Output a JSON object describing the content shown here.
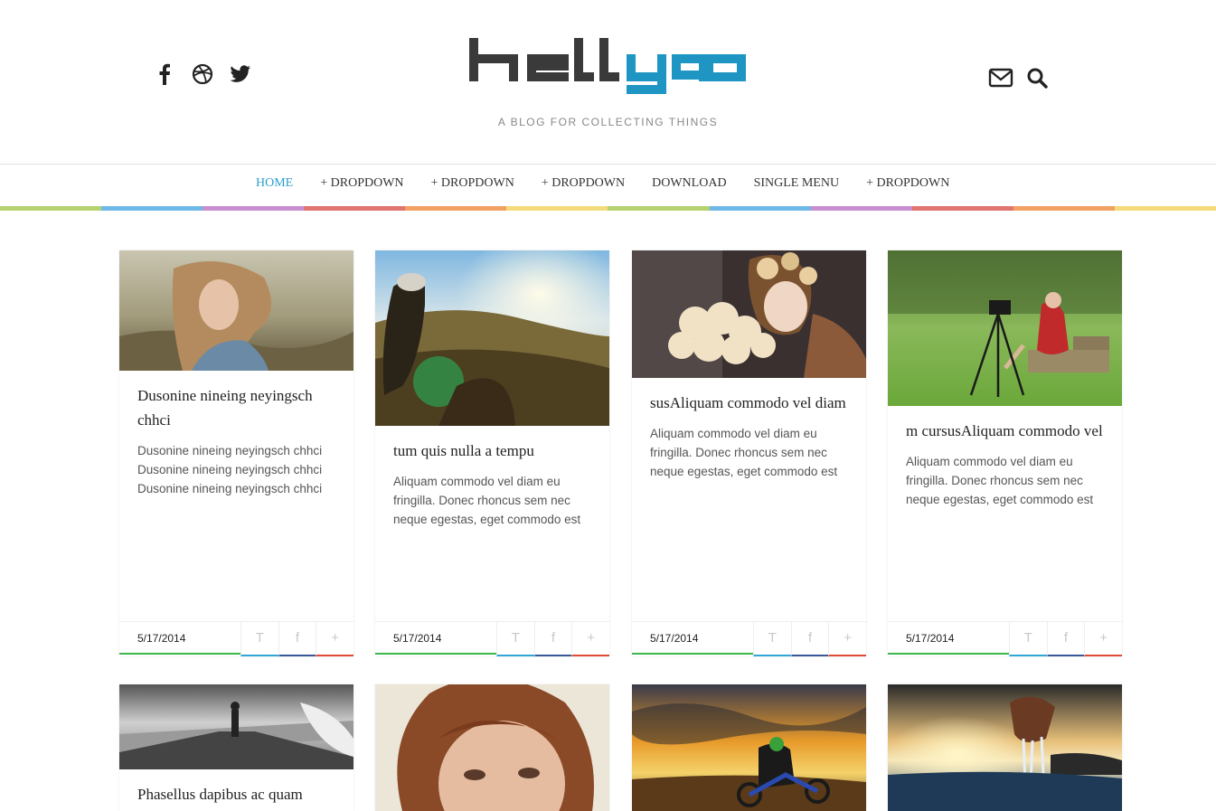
{
  "header": {
    "social_icons": [
      "facebook-icon",
      "dribbble-icon",
      "twitter-icon"
    ],
    "tool_icons": [
      "mail-icon",
      "search-icon"
    ],
    "logo_text": "hellya",
    "tagline": "A BLOG FOR COLLECTING THINGS"
  },
  "nav": {
    "items": [
      "HOME",
      "+ DROPDOWN",
      "+ DROPDOWN",
      "+ DROPDOWN",
      "DOWNLOAD",
      "SINGLE MENU",
      "+ DROPDOWN"
    ],
    "active_color": "#2a9fd0"
  },
  "stripe_colors": [
    "#b5d26f",
    "#6fb9e8",
    "#c98ed0",
    "#e0766f",
    "#f2a163",
    "#f4db7a",
    "#b5d26f",
    "#6fb9e8",
    "#c98ed0",
    "#e0766f",
    "#f2a163",
    "#f4db7a"
  ],
  "posts": [
    {
      "title": "Dusonine nineing neyingsch chhci",
      "excerpt": "Dusonine nineing neyingsch chhci Dusonine nineing neyingsch chhci Dusonine nineing neyingsch chhci",
      "date": "5/17/2014",
      "share": {
        "t": "T",
        "f": "f",
        "p": "+"
      }
    },
    {
      "title": "tum quis nulla a tempu",
      "excerpt": "Aliquam commodo vel diam eu fringilla. Donec rhoncus sem nec neque egestas, eget commodo est",
      "date": "5/17/2014",
      "share": {
        "t": "T",
        "f": "f",
        "p": "+"
      }
    },
    {
      "title": "susAliquam commodo vel diam",
      "excerpt": "Aliquam commodo vel diam eu fringilla. Donec rhoncus sem nec neque egestas, eget commodo est",
      "date": "5/17/2014",
      "share": {
        "t": "T",
        "f": "f",
        "p": "+"
      }
    },
    {
      "title": "m cursusAliquam commodo vel",
      "excerpt": "Aliquam commodo vel diam eu fringilla. Donec rhoncus sem nec neque egestas, eget commodo est",
      "date": "5/17/2014",
      "share": {
        "t": "T",
        "f": "f",
        "p": "+"
      }
    },
    {
      "title": "Phasellus dapibus ac quam"
    }
  ]
}
